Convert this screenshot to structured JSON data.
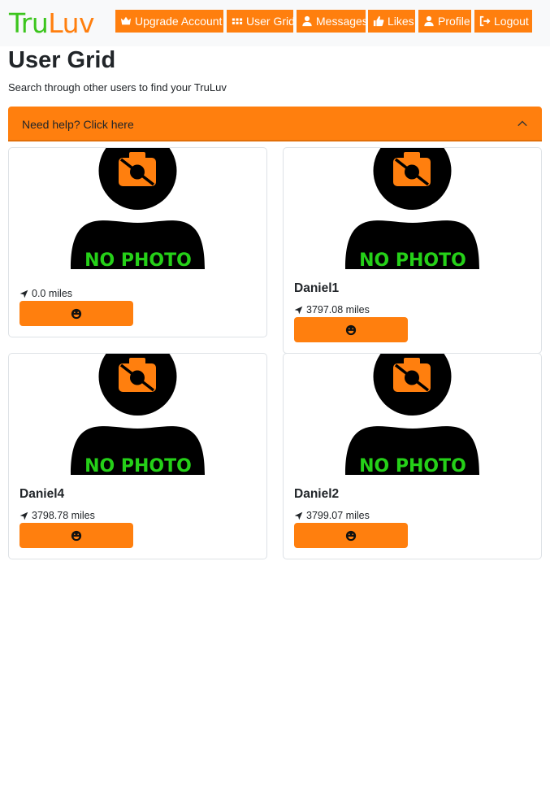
{
  "app": {
    "logo": {
      "part1": "Tru",
      "part2": "Luv"
    },
    "colors": {
      "accent": "#ff7f0e",
      "green": "#3cc51d",
      "topbar": "#f8f9fa"
    }
  },
  "nav": {
    "items": [
      {
        "label": "Upgrade Account",
        "icon": "crown-icon"
      },
      {
        "label": "User Grid",
        "icon": "grid-icon"
      },
      {
        "label": "Messages",
        "icon": "user-icon"
      },
      {
        "label": "Likes",
        "icon": "thumbs-up-icon"
      },
      {
        "label": "Profile",
        "icon": "user-icon"
      },
      {
        "label": "Logout",
        "icon": "logout-icon"
      }
    ]
  },
  "page": {
    "title": "User Grid",
    "subtitle": "Search through other users to find your TruLuv"
  },
  "help": {
    "label": "Need help? Click here",
    "icon": "chevron-up-icon"
  },
  "placeholder_photo": {
    "text": "NO PHOTO",
    "icon": "no-camera-icon"
  },
  "users": [
    {
      "name": "",
      "distance": "0.0 miles"
    },
    {
      "name": "Daniel1",
      "distance": "3797.08 miles"
    },
    {
      "name": "Daniel4",
      "distance": "3798.78 miles"
    },
    {
      "name": "Daniel2",
      "distance": "3799.07 miles"
    }
  ],
  "like_button": {
    "icon": "smile-icon"
  }
}
